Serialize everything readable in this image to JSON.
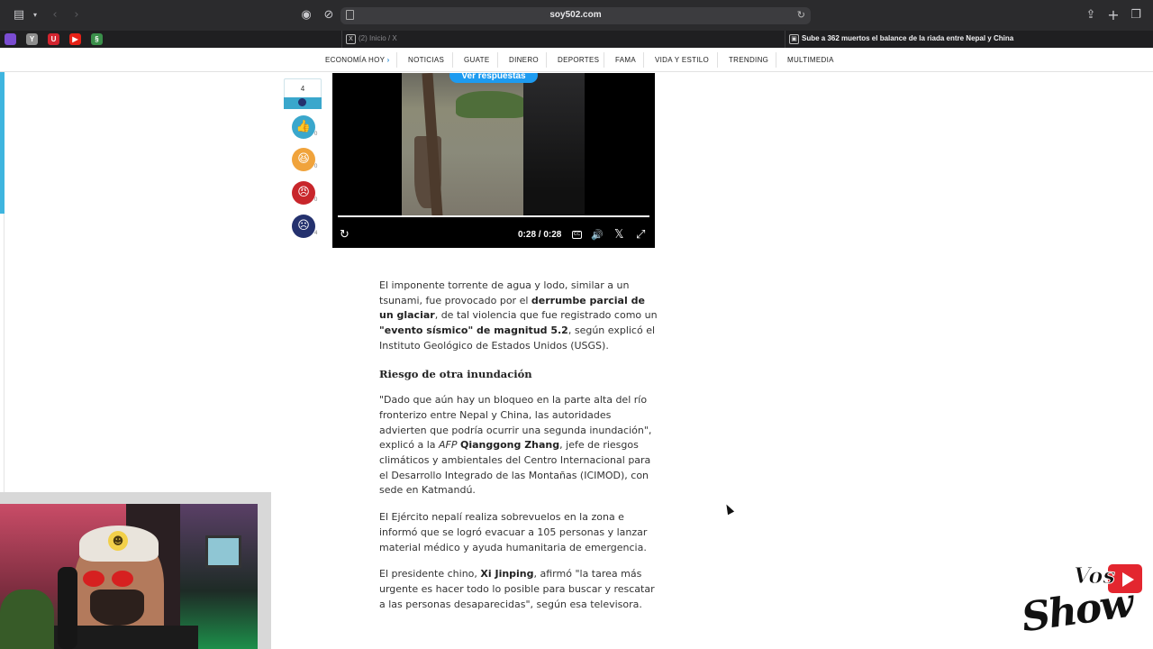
{
  "browser": {
    "url": "soy502.com",
    "icons": {
      "sidebar": "sidebar-icon",
      "back": "chevron-left-icon",
      "forward": "chevron-right-icon",
      "tracker": "shield-icon",
      "compass": "compass-icon",
      "reload": "reload-icon",
      "share": "share-icon",
      "new_tab": "plus-icon",
      "tabs": "tabs-overview-icon"
    },
    "pinned_tabs": [
      {
        "name": "pinned-tab-podcast",
        "glyph": "",
        "color": "#7a4cd1"
      },
      {
        "name": "pinned-tab-y",
        "glyph": "Y",
        "color": "#8e8e8e"
      },
      {
        "name": "pinned-tab-u",
        "glyph": "U",
        "color": "#d3242f"
      },
      {
        "name": "pinned-tab-youtube",
        "glyph": "▶",
        "color": "#e62117"
      },
      {
        "name": "pinned-tab-green",
        "glyph": "§",
        "color": "#3a8f4a"
      }
    ],
    "tabs": [
      {
        "label": "(2) Inicio / X",
        "favicon": "X",
        "active": false
      },
      {
        "label": "Sube a 362 muertos el balance de la riada entre Nepal y China",
        "favicon": "▣",
        "active": true
      }
    ]
  },
  "site_nav": {
    "items": [
      "ECONOMÍA HOY",
      "NOTICIAS",
      "GUATE",
      "DINERO",
      "DEPORTES",
      "FAMA",
      "VIDA Y ESTILO",
      "TRENDING",
      "MULTIMEDIA"
    ],
    "economia_chevron": "›"
  },
  "reactions": {
    "total": "4",
    "items": [
      {
        "name": "like-reaction-icon",
        "glyph": "👍",
        "bg": "#3aa7cc",
        "count": "0"
      },
      {
        "name": "laugh-reaction-icon",
        "glyph": "😆",
        "bg": "#f0a33b",
        "count": "0"
      },
      {
        "name": "angry-reaction-icon",
        "glyph": "😠",
        "bg": "#c8262b",
        "count": "0"
      },
      {
        "name": "sad-reaction-icon",
        "glyph": "☹",
        "bg": "#24316e",
        "count": "4"
      }
    ]
  },
  "video": {
    "replies_button": "Ver respuestas",
    "time": "0:28 / 0:28",
    "progress": 1.0,
    "cc_label": "CC",
    "icons": {
      "replay": "↻",
      "volume": "🔊",
      "x": "𝕏",
      "fullscreen": "⤢"
    }
  },
  "article": {
    "p1_a": "El imponente torrente de agua y lodo, similar a un tsunami, fue provocado por el ",
    "p1_b": "derrumbe parcial de un glaciar",
    "p1_c": ", de tal violencia que fue registrado como un ",
    "p1_d": "\"evento sísmico\" de magnitud 5.2",
    "p1_e": ", según explicó el Instituto Geológico de Estados Unidos (USGS).",
    "heading": "Riesgo de otra inundación",
    "p2_a": "\"Dado que aún hay un bloqueo en la parte alta del río fronterizo entre Nepal y China, las autoridades advierten que podría ocurrir una segunda inundación\", explicó a la ",
    "p2_afp": "AFP",
    "p2_name": "Qianggong Zhang",
    "p2_b": ", jefe de riesgos climáticos y ambientales del Centro Internacional para el Desarrollo Integrado de las Montañas (ICIMOD), con sede en Katmandú.",
    "p3": "El Ejército nepalí realiza sobrevuelos en la zona e informó que se logró evacuar a 105 personas y lanzar material médico y ayuda humanitaria de emergencia.",
    "p4_a": "El presidente chino, ",
    "p4_name": "Xi Jinping",
    "p4_b": ", afirmó \"la tarea más urgente es hacer todo lo posible para buscar y rescatar a las personas desaparecidas\", según esa televisora."
  },
  "overlay_logo": {
    "line1": "Vos",
    "line2": "Show"
  },
  "colors": {
    "accent": "#3aa7cc",
    "link": "#1d9bf0",
    "nav_chevron": "#2d8fd8"
  }
}
